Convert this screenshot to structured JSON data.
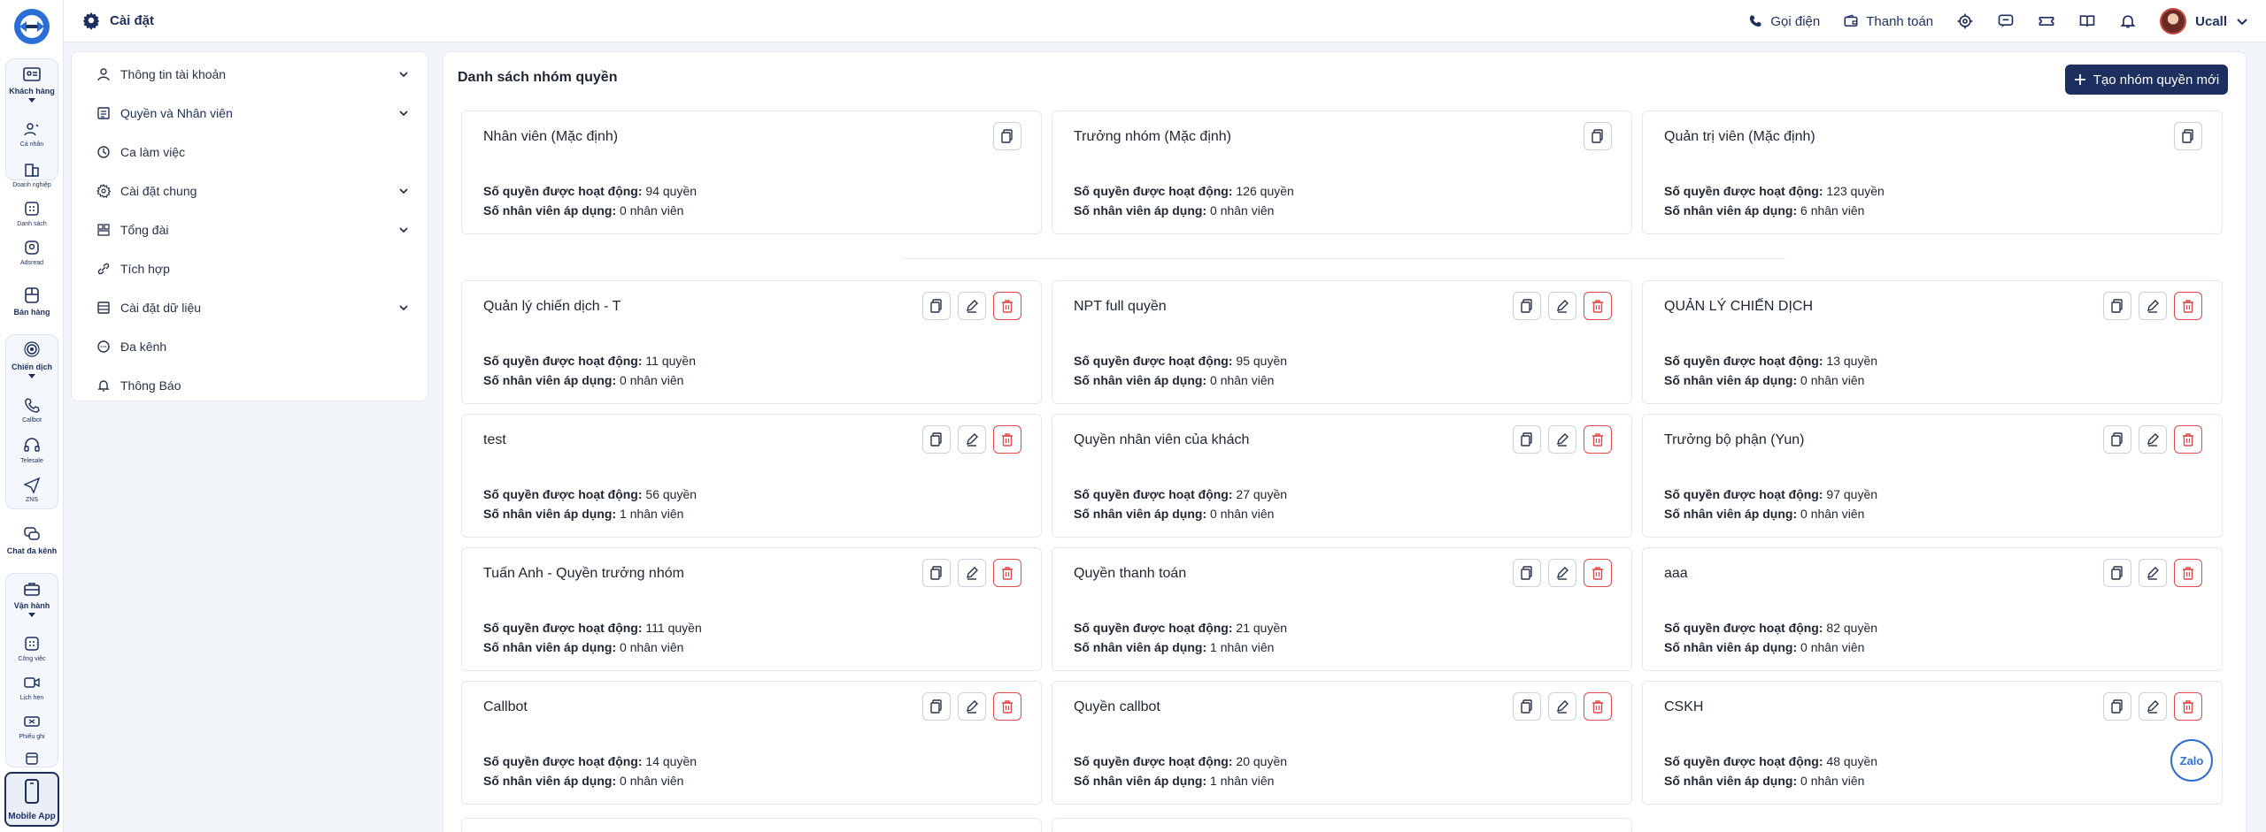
{
  "header": {
    "title": "Cài đặt",
    "call_label": "Gọi điện",
    "payment_label": "Thanh toán",
    "user_name": "Ucall"
  },
  "rail": {
    "items": [
      {
        "label": "Khách hàng"
      },
      {
        "label": "Cá nhân"
      },
      {
        "label": "Doanh nghiệp"
      },
      {
        "label": "Danh sách"
      },
      {
        "label": "Adsread"
      },
      {
        "label": "Bán hàng"
      },
      {
        "label": "Chiến dịch"
      },
      {
        "label": "Callbot"
      },
      {
        "label": "Telesale"
      },
      {
        "label": "ZNS"
      },
      {
        "label": "Chat đa kênh"
      },
      {
        "label": "Vận hành"
      },
      {
        "label": "Công việc"
      },
      {
        "label": "Lịch hẹn"
      },
      {
        "label": "Phiếu ghi"
      }
    ],
    "mobile_app_label": "Mobile App"
  },
  "menu": {
    "items": [
      {
        "label": "Thông tin tài khoản",
        "icon": "user-icon"
      },
      {
        "label": "Quyền và Nhân viên",
        "icon": "list-icon"
      },
      {
        "label": "Ca làm việc",
        "icon": "clock-icon"
      },
      {
        "label": "Cài đặt chung",
        "icon": "gear-icon"
      },
      {
        "label": "Tổng đài",
        "icon": "switchboard-icon"
      },
      {
        "label": "Tích hợp",
        "icon": "link-icon"
      },
      {
        "label": "Cài đặt dữ liệu",
        "icon": "data-icon"
      },
      {
        "label": "Đa kênh",
        "icon": "chat-icon"
      },
      {
        "label": "Thông Báo",
        "icon": "bell-icon"
      }
    ]
  },
  "main": {
    "title": "Danh sách nhóm quyền",
    "create_label": "Tạo nhóm quyền mới",
    "perm_label": "Số quyền được hoạt động:",
    "staff_label": "Số nhân viên áp dụng:",
    "default_groups": [
      {
        "name": "Nhân viên (Mặc định)",
        "perms": "94 quyền",
        "staff": "0 nhân viên"
      },
      {
        "name": "Trưởng nhóm (Mặc định)",
        "perms": "126 quyền",
        "staff": "0 nhân viên"
      },
      {
        "name": "Quản trị viên (Mặc định)",
        "perms": "123 quyền",
        "staff": "6 nhân viên"
      }
    ],
    "groups": [
      {
        "name": "Quản lý chiến dịch - T",
        "perms": "11 quyền",
        "staff": "0 nhân viên"
      },
      {
        "name": "NPT full quyền",
        "perms": "95 quyền",
        "staff": "0 nhân viên"
      },
      {
        "name": "QUẢN LÝ CHIẾN DỊCH",
        "perms": "13 quyền",
        "staff": "0 nhân viên"
      },
      {
        "name": "test",
        "perms": "56 quyền",
        "staff": "1 nhân viên"
      },
      {
        "name": "Quyền nhân viên của khách",
        "perms": "27 quyền",
        "staff": "0 nhân viên"
      },
      {
        "name": "Trưởng bộ phận (Yun)",
        "perms": "97 quyền",
        "staff": "0 nhân viên"
      },
      {
        "name": "Tuấn Anh - Quyền trưởng nhóm",
        "perms": "111 quyền",
        "staff": "0 nhân viên"
      },
      {
        "name": "Quyền thanh toán",
        "perms": "21 quyền",
        "staff": "1 nhân viên"
      },
      {
        "name": "aaa",
        "perms": "82 quyền",
        "staff": "0 nhân viên"
      },
      {
        "name": "Callbot",
        "perms": "14 quyền",
        "staff": "0 nhân viên"
      },
      {
        "name": "Quyền callbot",
        "perms": "20 quyền",
        "staff": "1 nhân viên"
      },
      {
        "name": "CSKH",
        "perms": "48 quyền",
        "staff": "0 nhân viên"
      }
    ]
  },
  "zalo_label": "Zalo",
  "colors": {
    "brand": "#1c2f5e",
    "danger": "#e04a4a",
    "border": "#e3e8ef"
  }
}
